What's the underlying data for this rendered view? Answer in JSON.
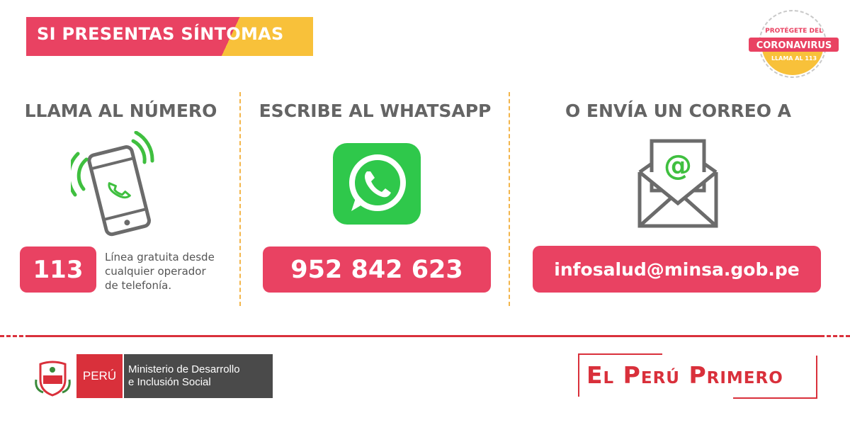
{
  "header": {
    "title": "SI PRESENTAS SÍNTOMAS"
  },
  "seal": {
    "line1": "PROTÉGETE DEL",
    "line2": "CORONAVIRUS",
    "line3": "LLAMA AL 113"
  },
  "call": {
    "title": "LLAMA AL NÚMERO",
    "number": "113",
    "note_lines": [
      "Línea gratuita desde",
      "cualquier operador",
      "de telefonía."
    ]
  },
  "whatsapp": {
    "title": "ESCRIBE AL WHATSAPP",
    "number": "952 842 623"
  },
  "mail": {
    "title": "O ENVÍA UN CORREO A",
    "address": "infosalud@minsa.gob.pe"
  },
  "footer": {
    "country": "PERÚ",
    "ministry_line1": "Ministerio de Desarrollo",
    "ministry_line2": "e Inclusión Social",
    "brand": "El Perú Primero"
  },
  "colors": {
    "accent": "#e94262",
    "yellow": "#f8c13a",
    "green": "#3fbf3f",
    "whatsapp_green": "#2fc84b",
    "gray": "#646464",
    "footer_red": "#d9303b"
  },
  "icons": [
    "phone-ringing-icon",
    "whatsapp-icon",
    "envelope-at-icon",
    "peru-shield-icon"
  ]
}
